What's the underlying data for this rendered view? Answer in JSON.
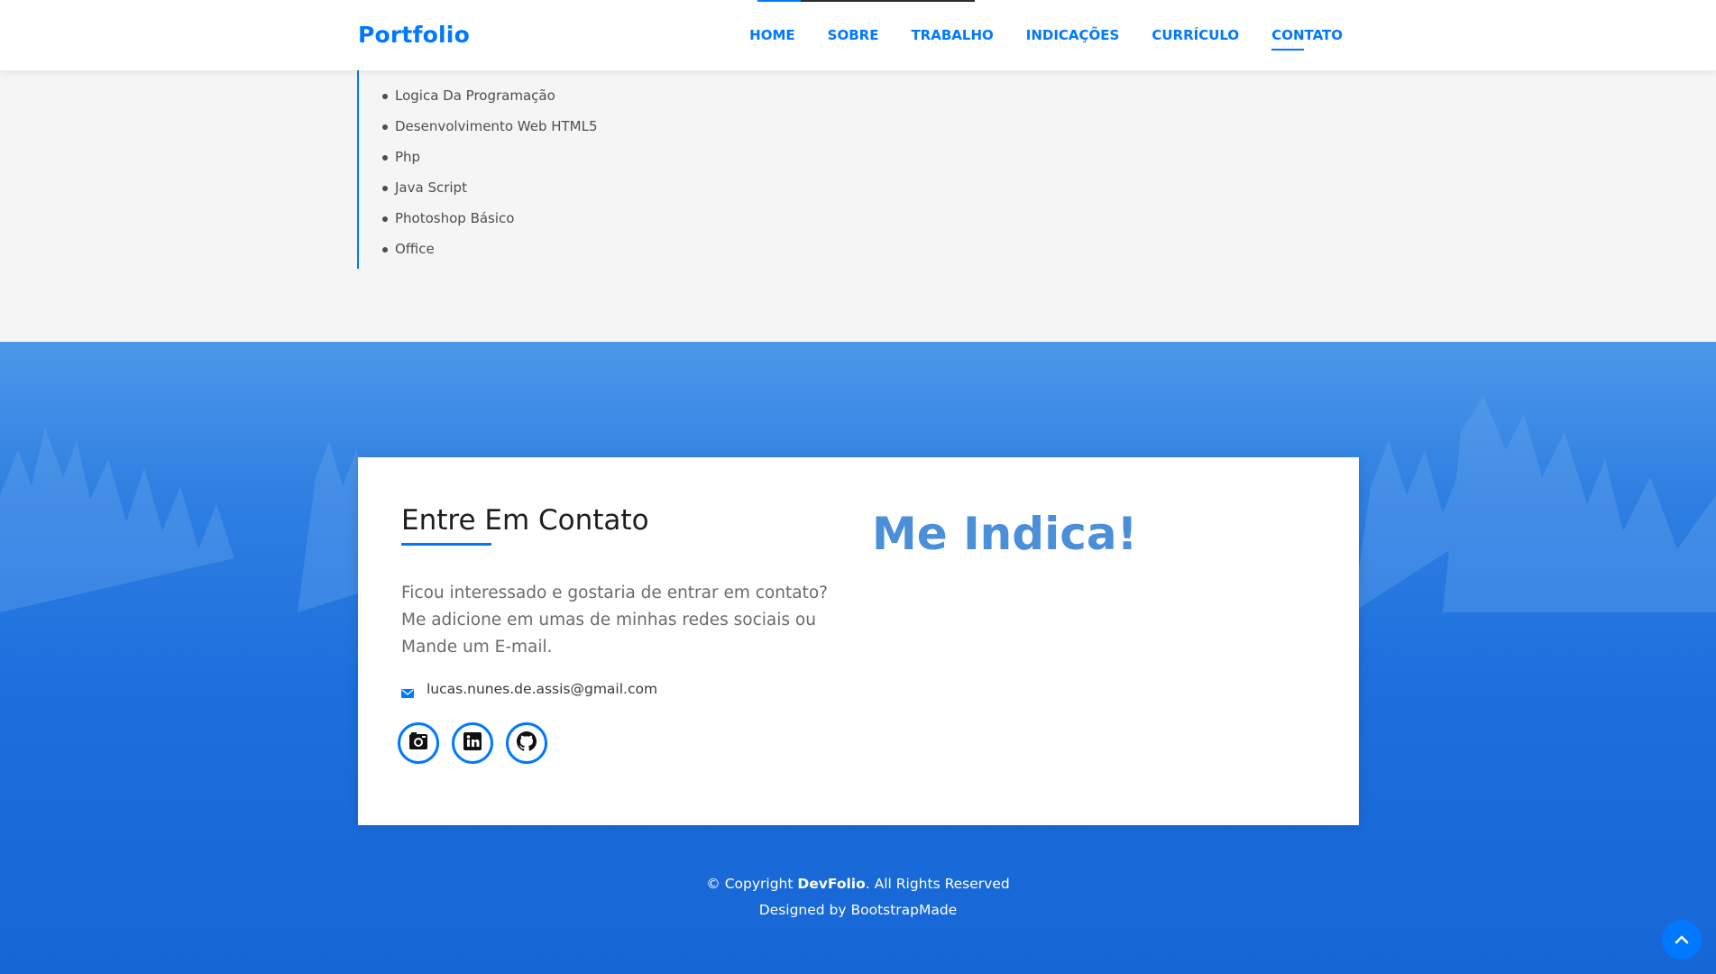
{
  "header": {
    "brand": "Portfolio",
    "nav": [
      "HOME",
      "SOBRE",
      "TRABALHO",
      "INDICAÇÕES",
      "CURRÍCULO",
      "CONTATO"
    ],
    "active": "CONTATO"
  },
  "skills": {
    "items": [
      "Logica Da Programação",
      "Desenvolvimento Web HTML5",
      "Php",
      "Java Script",
      "Photoshop Básico",
      "Office"
    ]
  },
  "contact": {
    "title": "Entre Em Contato",
    "text": "Ficou interessado e gostaria de entrar em contato? Me adicione em umas de minhas redes sociais ou Mande um E-mail.",
    "email": "lucas.nunes.de.assis@gmail.com",
    "socials": [
      "instagram-icon",
      "linkedin-icon",
      "github-icon"
    ],
    "aside_title": "Me Indica!"
  },
  "footer": {
    "copyright_prefix": "© Copyright ",
    "copyright_brand": "DevFolio",
    "copyright_suffix": ". All Rights Reserved",
    "designed_by": "Designed by BootstrapMade"
  },
  "colors": {
    "accent": "#0078ff",
    "aside_title": "#4a8fd8",
    "page_bg": "#f5f5f5"
  }
}
